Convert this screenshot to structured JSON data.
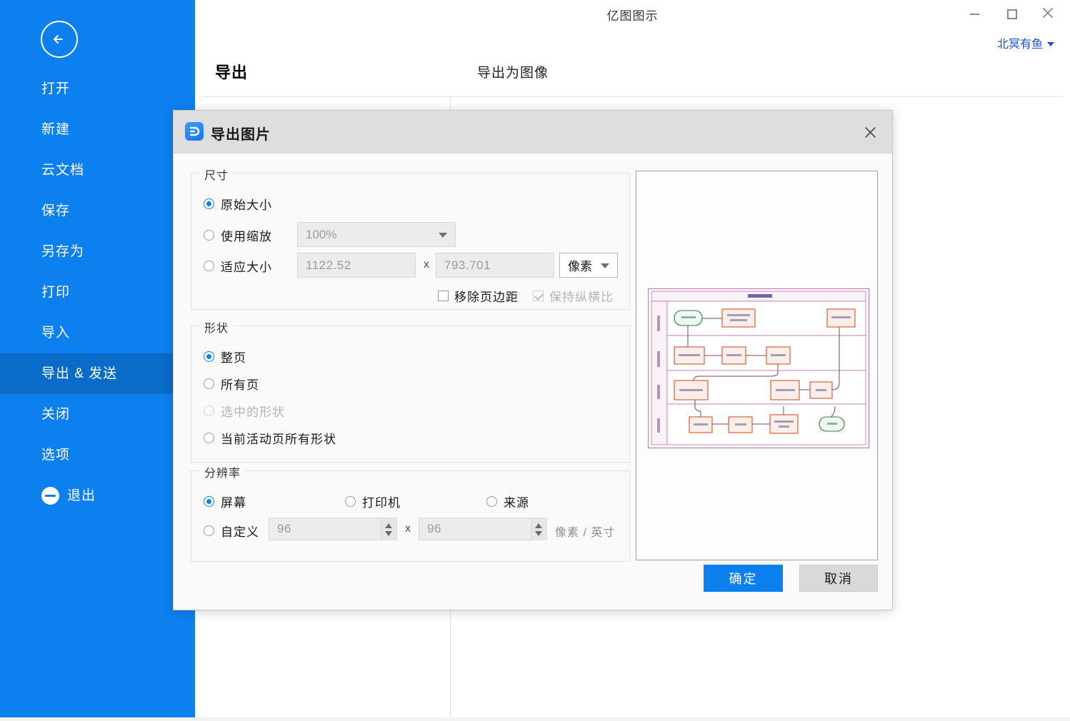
{
  "window": {
    "title": "亿图图示",
    "minimize_label": "最小化",
    "maximize_label": "最大化",
    "close_label": "关闭",
    "account_name": "北冥有鱼"
  },
  "sidebar": {
    "back_label": "返回",
    "items": [
      {
        "label": "打开",
        "active": false
      },
      {
        "label": "新建",
        "active": false
      },
      {
        "label": "云文档",
        "active": false
      },
      {
        "label": "保存",
        "active": false
      },
      {
        "label": "另存为",
        "active": false
      },
      {
        "label": "打印",
        "active": false
      },
      {
        "label": "导入",
        "active": false
      },
      {
        "label": "导出 & 发送",
        "active": true
      },
      {
        "label": "关闭",
        "active": false
      },
      {
        "label": "选项",
        "active": false
      }
    ],
    "exit_label": "退出",
    "accent_color": "#0c80ef",
    "active_color": "#0a6cc8"
  },
  "export_page": {
    "title": "导出",
    "subtitle": "导出为图像"
  },
  "dialog": {
    "title": "导出图片",
    "close_label": "×",
    "size": {
      "legend": "尺寸",
      "original_label": "原始大小",
      "original_selected": true,
      "scale_label": "使用缩放",
      "scale_selected": false,
      "scale_value": "100%",
      "fit_label": "适应大小",
      "fit_selected": false,
      "width_value": "1122.52",
      "height_value": "793.701",
      "x_separator": "x",
      "unit_value": "像素",
      "remove_margin_label": "移除页边距",
      "remove_margin_checked": false,
      "keep_ratio_label": "保持纵横比",
      "keep_ratio_checked": true,
      "keep_ratio_disabled": true
    },
    "shape": {
      "legend": "形状",
      "options": [
        {
          "label": "整页",
          "selected": true,
          "disabled": false
        },
        {
          "label": "所有页",
          "selected": false,
          "disabled": false
        },
        {
          "label": "选中的形状",
          "selected": false,
          "disabled": true
        },
        {
          "label": "当前活动页所有形状",
          "selected": false,
          "disabled": false
        }
      ]
    },
    "resolution": {
      "legend": "分辨率",
      "options": [
        {
          "label": "屏幕",
          "selected": true
        },
        {
          "label": "打印机",
          "selected": false
        },
        {
          "label": "来源",
          "selected": false
        }
      ],
      "custom_label": "自定义",
      "custom_selected": false,
      "dpi_x": "96",
      "dpi_y": "96",
      "x_separator": "x",
      "unit_label": "像素 / 英寸"
    },
    "buttons": {
      "ok": "确定",
      "cancel": "取消",
      "ok_color": "#0c80ef",
      "cancel_color": "#d9d9d9"
    },
    "preview": {
      "alt": "流程图预览缩略图"
    }
  }
}
